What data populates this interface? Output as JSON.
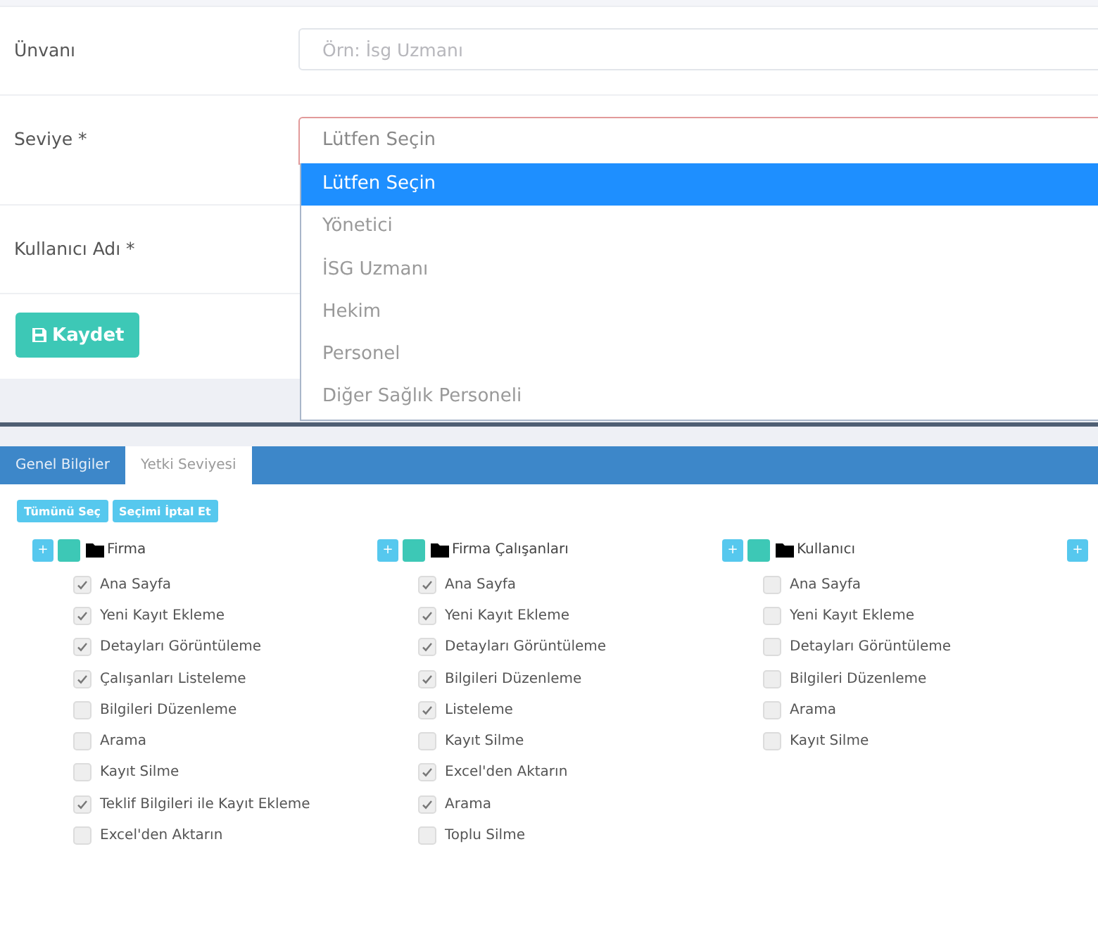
{
  "form": {
    "fields": [
      {
        "kind": "text",
        "label": "Ünvanı",
        "placeholder": "Örn: İsg Uzmanı"
      },
      {
        "kind": "select",
        "label": "Seviye *",
        "value": "Lütfen Seçin",
        "invalid": true,
        "expanded": true,
        "options": [
          {
            "label": "Lütfen Seçin",
            "selected": true
          },
          {
            "label": "Yönetici",
            "selected": false
          },
          {
            "label": "İSG Uzmanı",
            "selected": false
          },
          {
            "label": "Hekim",
            "selected": false
          },
          {
            "label": "Personel",
            "selected": false
          },
          {
            "label": "Diğer Sağlık Personeli",
            "selected": false
          }
        ]
      },
      {
        "kind": "label",
        "label": "Kullanıcı Adı *"
      }
    ],
    "save_button": {
      "label": "Kaydet"
    }
  },
  "tabs": [
    {
      "label": "Genel Bilgiler",
      "selected": false
    },
    {
      "label": "Yetki Seviyesi",
      "selected": true
    }
  ],
  "actions": [
    "Tümünü Seç",
    "Seçimi İptal Et"
  ],
  "groups": [
    {
      "expand_label": "+",
      "name": "Firma",
      "items": [
        {
          "label": "Ana Sayfa",
          "checked": true
        },
        {
          "label": "Yeni Kayıt Ekleme",
          "checked": true
        },
        {
          "label": "Detayları Görüntüleme",
          "checked": true
        },
        {
          "label": "Çalışanları Listeleme",
          "checked": true
        },
        {
          "label": "Bilgileri Düzenleme",
          "checked": false
        },
        {
          "label": "Arama",
          "checked": false
        },
        {
          "label": "Kayıt Silme",
          "checked": false
        },
        {
          "label": "Teklif Bilgileri ile Kayıt Ekleme",
          "checked": true
        },
        {
          "label": "Excel'den Aktarın",
          "checked": false
        }
      ]
    },
    {
      "expand_label": "+",
      "name": "Firma Çalışanları",
      "items": [
        {
          "label": "Ana Sayfa",
          "checked": true
        },
        {
          "label": "Yeni Kayıt Ekleme",
          "checked": true
        },
        {
          "label": "Detayları Görüntüleme",
          "checked": true
        },
        {
          "label": "Bilgileri Düzenleme",
          "checked": true
        },
        {
          "label": "Listeleme",
          "checked": true
        },
        {
          "label": "Kayıt Silme",
          "checked": false
        },
        {
          "label": "Excel'den Aktarın",
          "checked": true
        },
        {
          "label": "Arama",
          "checked": true
        },
        {
          "label": "Toplu Silme",
          "checked": false
        }
      ]
    },
    {
      "expand_label": "+",
      "name": "Kullanıcı",
      "items": [
        {
          "label": "Ana Sayfa",
          "checked": false
        },
        {
          "label": "Yeni Kayıt Ekleme",
          "checked": false
        },
        {
          "label": "Detayları Görüntüleme",
          "checked": false
        },
        {
          "label": "Bilgileri Düzenleme",
          "checked": false
        },
        {
          "label": "Arama",
          "checked": false
        },
        {
          "label": "Kayıt Silme",
          "checked": false
        }
      ]
    },
    {
      "expand_label": "+"
    }
  ]
}
